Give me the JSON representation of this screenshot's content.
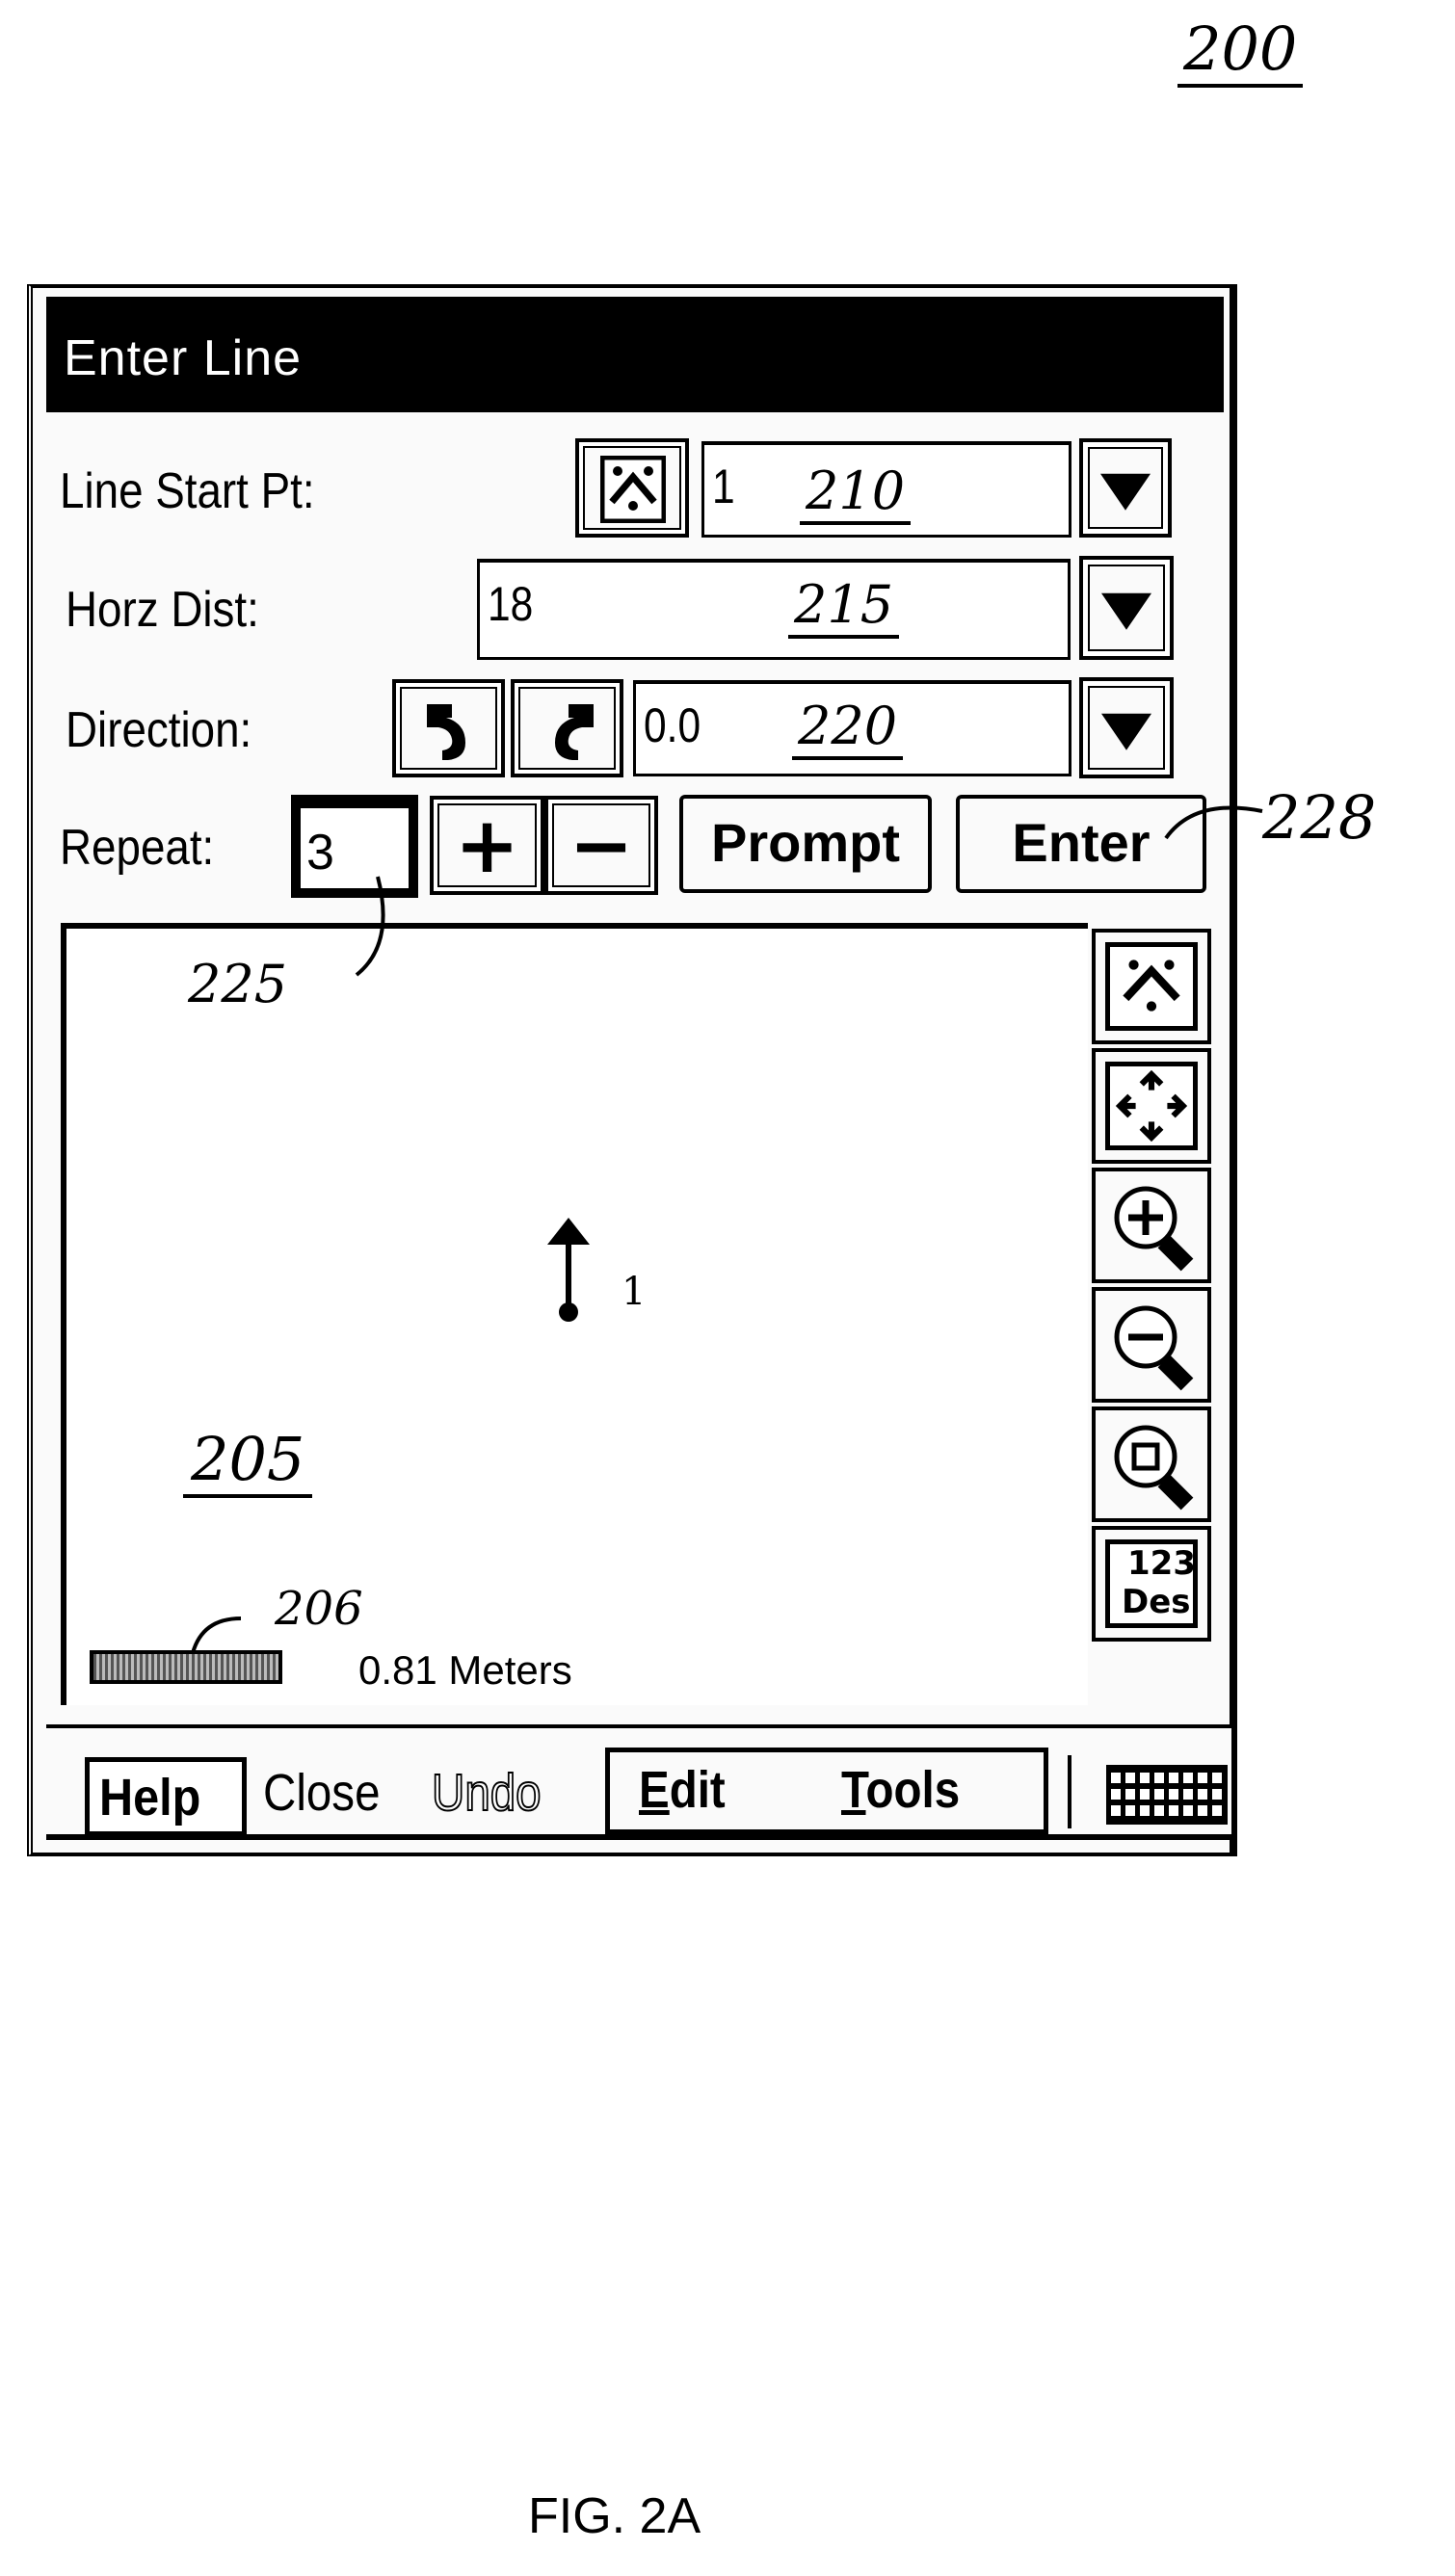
{
  "annotations": {
    "figure_ref": "200",
    "ref_start_point": "210",
    "ref_horz_dist": "215",
    "ref_direction": "220",
    "ref_enter": "228",
    "ref_repeat": "225",
    "ref_canvas": "205",
    "ref_scale_bar": "206",
    "caption": "FIG. 2A"
  },
  "window": {
    "title": "Enter Line"
  },
  "form": {
    "line_start": {
      "label": "Line Start Pt:",
      "value": "1",
      "pick_icon": "pick-point-icon",
      "dropdown_icon": "triangle-down-icon"
    },
    "horz_dist": {
      "label": "Horz Dist:",
      "value": "18",
      "dropdown_icon": "triangle-down-icon"
    },
    "direction": {
      "label": "Direction:",
      "value": "0.0",
      "rotate_left_icon": "rotate-left-icon",
      "rotate_right_icon": "rotate-right-icon",
      "dropdown_icon": "triangle-down-icon"
    },
    "repeat": {
      "label": "Repeat:",
      "value": "3",
      "plus_label": "+",
      "minus_label": "−"
    },
    "prompt_label": "Prompt",
    "enter_label": "Enter"
  },
  "canvas": {
    "point_label": "1",
    "scale_text": "0.81 Meters"
  },
  "toolbar": {
    "items": [
      {
        "name": "pick-point",
        "icon": "pick-point-icon"
      },
      {
        "name": "pan",
        "icon": "pan-arrows-icon"
      },
      {
        "name": "zoom-in",
        "icon": "zoom-in-icon"
      },
      {
        "name": "zoom-out",
        "icon": "zoom-out-icon"
      },
      {
        "name": "zoom-extents",
        "icon": "zoom-extents-icon"
      },
      {
        "name": "units",
        "icon": "units-icon",
        "top_text": "123",
        "bottom_text": "Des"
      }
    ]
  },
  "menubar": {
    "help": "Help",
    "close": "Close",
    "undo": "Undo",
    "edit": "Edit",
    "edit_mnemonic": "E",
    "edit_rest": "dit",
    "tools_mnemonic": "T",
    "tools_rest": "ools",
    "keyboard_icon": "keyboard-icon"
  }
}
